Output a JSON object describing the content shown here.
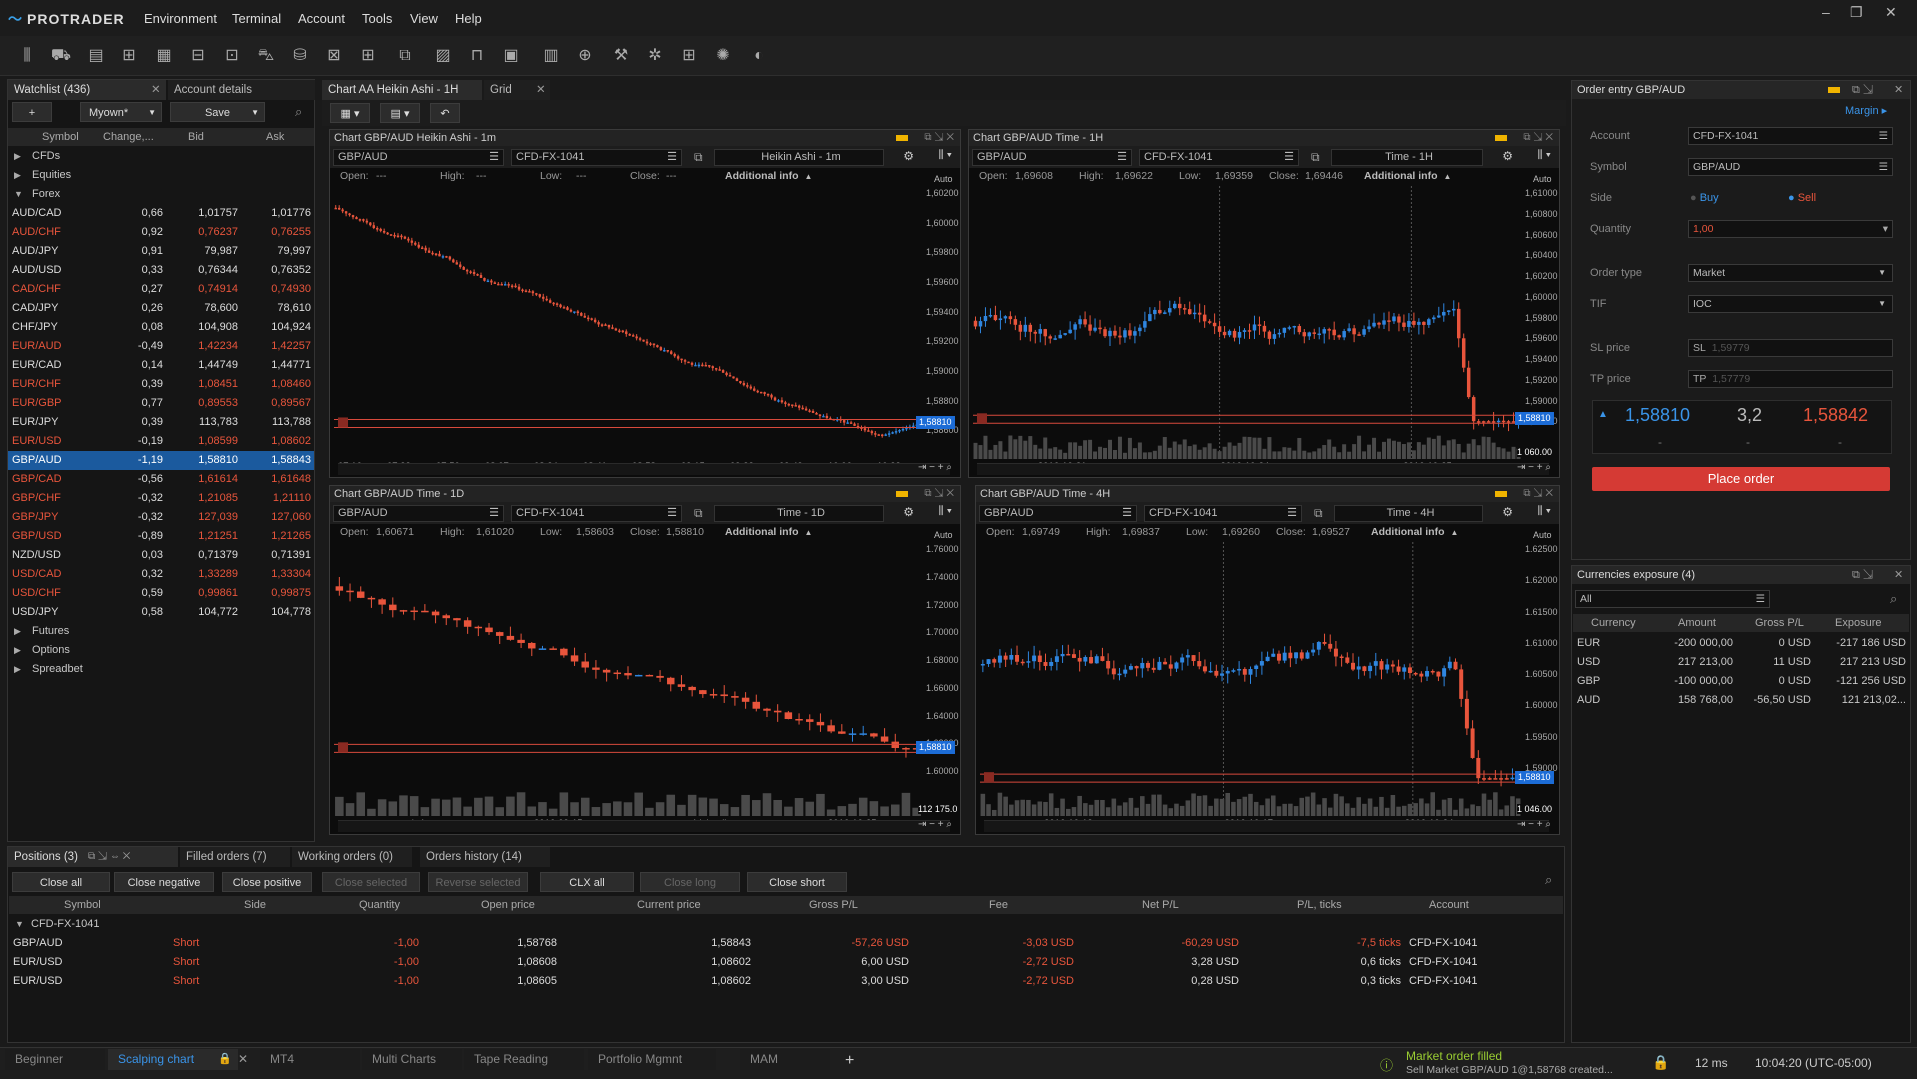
{
  "app": {
    "name": "PROTRADER",
    "menu": [
      "Environment",
      "Terminal",
      "Account",
      "Tools",
      "View",
      "Help"
    ]
  },
  "colors": {
    "accent": "#1c6cd6",
    "up": "#2f86e0",
    "down": "#e8553c",
    "place_order": "#d53a34"
  },
  "watchlist": {
    "tab": "Watchlist (436)",
    "tab2": "Account details",
    "add_label": "+",
    "list_select": "Myown*",
    "save_label": "Save",
    "columns": [
      "Symbol",
      "Change,...",
      "Bid",
      "Ask"
    ],
    "groups_top": [
      "CFDs",
      "Equities",
      "Forex"
    ],
    "rows": [
      {
        "symbol": "AUD/CAD",
        "change": "0,66",
        "bid": "1,01757",
        "ask": "1,01776",
        "dir": "up"
      },
      {
        "symbol": "AUD/CHF",
        "change": "0,92",
        "bid": "0,76237",
        "ask": "0,76255",
        "dir": "down"
      },
      {
        "symbol": "AUD/JPY",
        "change": "0,91",
        "bid": "79,987",
        "ask": "79,997",
        "dir": "up"
      },
      {
        "symbol": "AUD/USD",
        "change": "0,33",
        "bid": "0,76344",
        "ask": "0,76352",
        "dir": "up"
      },
      {
        "symbol": "CAD/CHF",
        "change": "0,27",
        "bid": "0,74914",
        "ask": "0,74930",
        "dir": "down"
      },
      {
        "symbol": "CAD/JPY",
        "change": "0,26",
        "bid": "78,600",
        "ask": "78,610",
        "dir": "up"
      },
      {
        "symbol": "CHF/JPY",
        "change": "0,08",
        "bid": "104,908",
        "ask": "104,924",
        "dir": "up"
      },
      {
        "symbol": "EUR/AUD",
        "change": "-0,49",
        "bid": "1,42234",
        "ask": "1,42257",
        "dir": "down"
      },
      {
        "symbol": "EUR/CAD",
        "change": "0,14",
        "bid": "1,44749",
        "ask": "1,44771",
        "dir": "up"
      },
      {
        "symbol": "EUR/CHF",
        "change": "0,39",
        "bid": "1,08451",
        "ask": "1,08460",
        "dir": "down"
      },
      {
        "symbol": "EUR/GBP",
        "change": "0,77",
        "bid": "0,89553",
        "ask": "0,89567",
        "dir": "down"
      },
      {
        "symbol": "EUR/JPY",
        "change": "0,39",
        "bid": "113,783",
        "ask": "113,788",
        "dir": "up"
      },
      {
        "symbol": "EUR/USD",
        "change": "-0,19",
        "bid": "1,08599",
        "ask": "1,08602",
        "dir": "down"
      },
      {
        "symbol": "GBP/AUD",
        "change": "-1,19",
        "bid": "1,58810",
        "ask": "1,58843",
        "dir": "sel"
      },
      {
        "symbol": "GBP/CAD",
        "change": "-0,56",
        "bid": "1,61614",
        "ask": "1,61648",
        "dir": "down"
      },
      {
        "symbol": "GBP/CHF",
        "change": "-0,32",
        "bid": "1,21085",
        "ask": "1,21110",
        "dir": "down"
      },
      {
        "symbol": "GBP/JPY",
        "change": "-0,32",
        "bid": "127,039",
        "ask": "127,060",
        "dir": "down"
      },
      {
        "symbol": "GBP/USD",
        "change": "-0,89",
        "bid": "1,21251",
        "ask": "1,21265",
        "dir": "down"
      },
      {
        "symbol": "NZD/USD",
        "change": "0,03",
        "bid": "0,71379",
        "ask": "0,71391",
        "dir": "up"
      },
      {
        "symbol": "USD/CAD",
        "change": "0,32",
        "bid": "1,33289",
        "ask": "1,33304",
        "dir": "down"
      },
      {
        "symbol": "USD/CHF",
        "change": "0,59",
        "bid": "0,99861",
        "ask": "0,99875",
        "dir": "down"
      },
      {
        "symbol": "USD/JPY",
        "change": "0,58",
        "bid": "104,772",
        "ask": "104,778",
        "dir": "up"
      }
    ],
    "groups_bottom": [
      "Futures",
      "Options",
      "Spreadbet"
    ]
  },
  "workspace_tabs": [
    "Chart AA Heikin Ashi - 1H",
    "Grid"
  ],
  "charts": [
    {
      "title": "Chart GBP/AUD Heikin Ashi - 1m",
      "symbol": "GBP/AUD",
      "account": "CFD-FX-1041",
      "timeframe": "Heikin Ashi - 1m",
      "open": "---",
      "high": "---",
      "low": "---",
      "close": "---",
      "info": "Additional info",
      "auto": "Auto",
      "price_tag": "1,58810",
      "y_ticks": [
        "1,60200",
        "1,60000",
        "1,59800",
        "1,59600",
        "1,59400",
        "1,59200",
        "1,59000",
        "1,58800",
        "1,58600"
      ],
      "x_ticks": [
        "07:16",
        "07:33",
        "07:50",
        "08:07",
        "08:24",
        "08:41",
        "08:58",
        "09:15",
        "09:32",
        "09:49",
        "10:06",
        "10:23"
      ],
      "volume_tag": ""
    },
    {
      "title": "Chart GBP/AUD Time - 1H",
      "symbol": "GBP/AUD",
      "account": "CFD-FX-1041",
      "timeframe": "Time - 1H",
      "open": "1,69608",
      "high": "1,69622",
      "low": "1,69359",
      "close": "1,69446",
      "info": "Additional info",
      "auto": "Auto",
      "price_tag": "1,58810",
      "y_ticks": [
        "1,61000",
        "1,60800",
        "1,60600",
        "1,60400",
        "1,60200",
        "1,60000",
        "1,59800",
        "1,59600",
        "1,59400",
        "1,59200",
        "1,59000",
        "1,58800"
      ],
      "x_ticks": [
        "2016-10-21",
        "2016-10-24",
        "2016-10-25"
      ],
      "volume_tag": "1 060.00"
    },
    {
      "title": "Chart GBP/AUD Time - 1D",
      "symbol": "GBP/AUD",
      "account": "CFD-FX-1041",
      "timeframe": "Time - 1D",
      "open": "1,60671",
      "high": "1,61020",
      "low": "1,58603",
      "close": "1,58810",
      "info": "Additional info",
      "auto": "Auto",
      "price_tag": "1,58810",
      "y_ticks": [
        "1.76000",
        "1.74000",
        "1.72000",
        "1.70000",
        "1.68000",
        "1.66000",
        "1.64000",
        "1.62000",
        "1.60000"
      ],
      "x_ticks": [
        "wrzesień",
        "2016-09-15",
        "październik",
        "2016-10-25"
      ],
      "volume_tag": "112 175.0"
    },
    {
      "title": "Chart GBP/AUD Time - 4H",
      "symbol": "GBP/AUD",
      "account": "CFD-FX-1041",
      "timeframe": "Time - 4H",
      "open": "1,69749",
      "high": "1,69837",
      "low": "1,69260",
      "close": "1,69527",
      "info": "Additional info",
      "auto": "Auto",
      "price_tag": "1,58810",
      "y_ticks": [
        "1.62500",
        "1.62000",
        "1.61500",
        "1.61000",
        "1.60500",
        "1.60000",
        "1.59500",
        "1.59000"
      ],
      "x_ticks": [
        "2016-10-12",
        "2016-10-17",
        "2016-10-24"
      ],
      "volume_tag": "1 046.00"
    }
  ],
  "order_entry": {
    "title": "Order entry GBP/AUD",
    "margin": "Margin",
    "account_label": "Account",
    "account": "CFD-FX-1041",
    "symbol_label": "Symbol",
    "symbol": "GBP/AUD",
    "side_label": "Side",
    "buy": "Buy",
    "sell": "Sell",
    "quantity_label": "Quantity",
    "quantity": "1,00",
    "order_type_label": "Order type",
    "order_type": "Market",
    "tif_label": "TIF",
    "tif": "IOC",
    "sl_label": "SL price",
    "sl_prefix": "SL",
    "sl_value": "1,59779",
    "tp_label": "TP price",
    "tp_prefix": "TP",
    "tp_value": "1,57779",
    "bid": "1,58810",
    "spread": "3,2",
    "ask": "1,58842",
    "dash": "-",
    "place_order": "Place order"
  },
  "exposure": {
    "title": "Currencies exposure (4)",
    "filter": "All",
    "columns": [
      "Currency",
      "Amount",
      "Gross P/L",
      "Exposure"
    ],
    "rows": [
      {
        "currency": "EUR",
        "amount": "-200 000,00",
        "gross": "0 USD",
        "exposure": "-217 186 USD"
      },
      {
        "currency": "USD",
        "amount": "217 213,00",
        "gross": "11 USD",
        "exposure": "217 213 USD"
      },
      {
        "currency": "GBP",
        "amount": "-100 000,00",
        "gross": "0 USD",
        "exposure": "-121 256 USD"
      },
      {
        "currency": "AUD",
        "amount": "158 768,00",
        "gross": "-56,50 USD",
        "exposure": "121 213,02..."
      }
    ]
  },
  "positions": {
    "tabs": [
      "Positions (3)",
      "Filled orders (7)",
      "Working orders (0)",
      "Orders history (14)"
    ],
    "buttons": [
      "Close all",
      "Close negative",
      "Close positive",
      "Close selected",
      "Reverse selected",
      "CLX all",
      "Close long",
      "Close short"
    ],
    "columns": [
      "Symbol",
      "Side",
      "Quantity",
      "Open price",
      "Current price",
      "Gross P/L",
      "Fee",
      "Net P/L",
      "P/L, ticks",
      "Account"
    ],
    "group": "CFD-FX-1041",
    "rows": [
      {
        "symbol": "GBP/AUD",
        "side": "Short",
        "qty": "-1,00",
        "open": "1,58768",
        "current": "1,58843",
        "gross": "-57,26 USD",
        "fee": "-3,03 USD",
        "net": "-60,29 USD",
        "ticks": "-7,5 ticks",
        "account": "CFD-FX-1041"
      },
      {
        "symbol": "EUR/USD",
        "side": "Short",
        "qty": "-1,00",
        "open": "1,08608",
        "current": "1,08602",
        "gross": "6,00 USD",
        "fee": "-2,72 USD",
        "net": "3,28 USD",
        "ticks": "0,6 ticks",
        "account": "CFD-FX-1041"
      },
      {
        "symbol": "EUR/USD",
        "side": "Short",
        "qty": "-1,00",
        "open": "1,08605",
        "current": "1,08602",
        "gross": "3,00 USD",
        "fee": "-2,72 USD",
        "net": "0,28 USD",
        "ticks": "0,3 ticks",
        "account": "CFD-FX-1041"
      }
    ]
  },
  "status": {
    "workspaces": [
      "Beginner",
      "Scalping chart",
      "MT4",
      "Multi Charts",
      "Tape Reading",
      "Portfolio Mgmnt",
      "MAM"
    ],
    "add": "+",
    "notice_title": "Market order filled",
    "notice_text": "Sell Market GBP/AUD 1@1,58768 created...",
    "latency": "12 ms",
    "clock": "10:04:20 (UTC-05:00)"
  }
}
